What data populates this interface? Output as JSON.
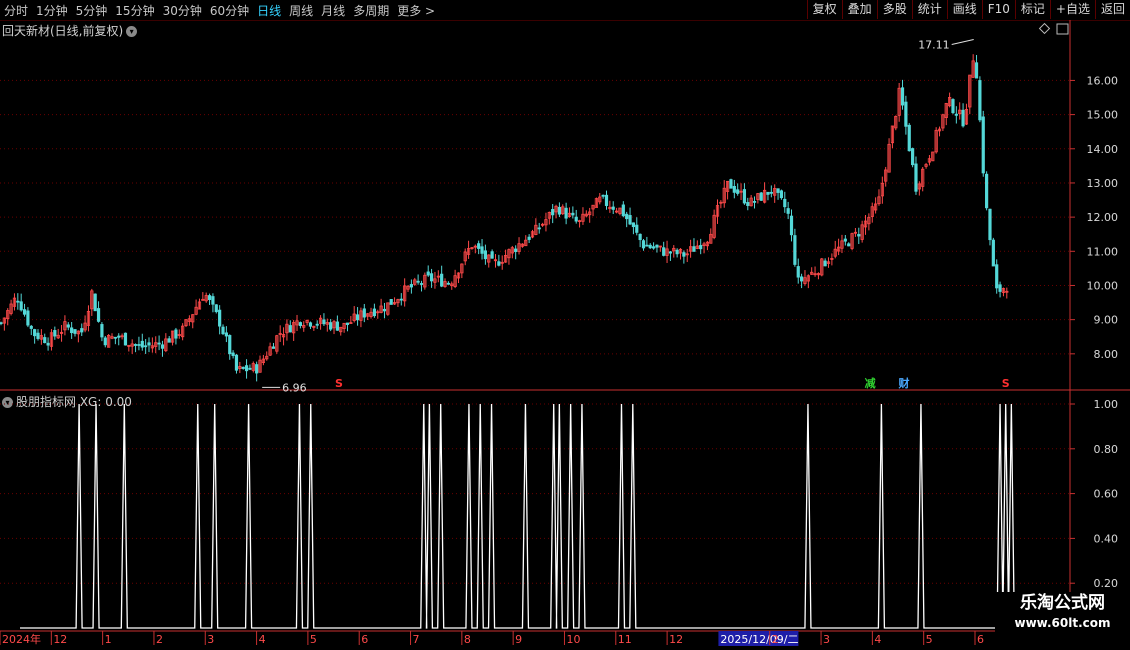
{
  "toolbar": {
    "timeframes": [
      {
        "label": "分时",
        "active": false
      },
      {
        "label": "1分钟",
        "active": false
      },
      {
        "label": "5分钟",
        "active": false
      },
      {
        "label": "15分钟",
        "active": false
      },
      {
        "label": "30分钟",
        "active": false
      },
      {
        "label": "60分钟",
        "active": false
      },
      {
        "label": "日线",
        "active": true
      },
      {
        "label": "周线",
        "active": false
      },
      {
        "label": "月线",
        "active": false
      },
      {
        "label": "多周期",
        "active": false
      },
      {
        "label": "更多 >",
        "active": false
      }
    ],
    "buttons": [
      "复权",
      "叠加",
      "多股",
      "统计",
      "画线",
      "F10",
      "标记",
      "+自选",
      "返回"
    ]
  },
  "main_title": "回天新材(日线,前复权)",
  "indicator_title": "股朋指标网 XG: 0.00",
  "watermark": {
    "line1": "乐淘公式网",
    "line2": "www.60lt.com"
  },
  "colors": {
    "up": "#ff4a4a",
    "down": "#54d8d8",
    "grid": "#6a0000",
    "axis": "#c83030",
    "signal": "#ffffff",
    "date_highlight": "#1e1ea8"
  },
  "chart_data": [
    {
      "type": "candlestick",
      "x_labels": [
        "2024年",
        "12",
        "1",
        "2",
        "3",
        "4",
        "5",
        "6",
        "7",
        "8",
        "9",
        "10",
        "11",
        "12",
        "2025/12/09/二",
        "2",
        "3",
        "4",
        "5",
        "6"
      ],
      "y_ticks": [
        "8.00",
        "9.00",
        "10.00",
        "11.00",
        "12.00",
        "13.00",
        "14.00",
        "15.00",
        "16.00"
      ],
      "ylim": [
        7.0,
        17.3
      ],
      "annotations": [
        {
          "text": "17.11",
          "value": 17.11,
          "kind": "high"
        },
        {
          "text": "6.96",
          "value": 6.96,
          "kind": "low"
        }
      ],
      "event_markers": [
        {
          "text": "S",
          "color": "#ff3030",
          "position": 0.3
        },
        {
          "text": "减",
          "color": "#30d030",
          "position": 0.77
        },
        {
          "text": "财",
          "color": "#4aa8ff",
          "position": 0.8
        },
        {
          "text": "S",
          "color": "#ff3030",
          "position": 0.89
        }
      ],
      "close_path": [
        [
          0.0,
          8.9
        ],
        [
          0.015,
          9.7
        ],
        [
          0.03,
          8.6
        ],
        [
          0.045,
          8.4
        ],
        [
          0.06,
          8.8
        ],
        [
          0.075,
          8.6
        ],
        [
          0.085,
          9.8
        ],
        [
          0.095,
          8.4
        ],
        [
          0.11,
          8.5
        ],
        [
          0.13,
          8.2
        ],
        [
          0.15,
          8.3
        ],
        [
          0.17,
          8.7
        ],
        [
          0.19,
          9.8
        ],
        [
          0.205,
          8.9
        ],
        [
          0.22,
          7.5
        ],
        [
          0.24,
          7.6
        ],
        [
          0.26,
          8.6
        ],
        [
          0.28,
          9.0
        ],
        [
          0.3,
          8.9
        ],
        [
          0.32,
          8.8
        ],
        [
          0.34,
          9.2
        ],
        [
          0.36,
          9.4
        ],
        [
          0.38,
          9.9
        ],
        [
          0.4,
          10.2
        ],
        [
          0.42,
          10.1
        ],
        [
          0.44,
          11.2
        ],
        [
          0.46,
          10.6
        ],
        [
          0.48,
          11.1
        ],
        [
          0.5,
          11.6
        ],
        [
          0.52,
          12.3
        ],
        [
          0.54,
          11.8
        ],
        [
          0.56,
          12.5
        ],
        [
          0.58,
          12.2
        ],
        [
          0.6,
          11.2
        ],
        [
          0.62,
          11.0
        ],
        [
          0.64,
          10.9
        ],
        [
          0.66,
          11.4
        ],
        [
          0.68,
          13.0
        ],
        [
          0.7,
          12.4
        ],
        [
          0.72,
          12.8
        ],
        [
          0.735,
          12.2
        ],
        [
          0.745,
          10.1
        ],
        [
          0.76,
          10.4
        ],
        [
          0.78,
          11.0
        ],
        [
          0.8,
          11.5
        ],
        [
          0.82,
          12.4
        ],
        [
          0.84,
          15.7
        ],
        [
          0.855,
          12.9
        ],
        [
          0.87,
          14.0
        ],
        [
          0.885,
          15.4
        ],
        [
          0.9,
          14.8
        ],
        [
          0.91,
          17.0
        ],
        [
          0.92,
          12.5
        ],
        [
          0.93,
          9.8
        ],
        [
          0.94,
          10.0
        ]
      ]
    },
    {
      "type": "line",
      "name": "XG",
      "y_ticks": [
        "0.20",
        "0.40",
        "0.60",
        "0.80",
        "1.00"
      ],
      "ylim": [
        0,
        1.0
      ],
      "signals": [
        0.07,
        0.085,
        0.11,
        0.175,
        0.19,
        0.22,
        0.265,
        0.275,
        0.375,
        0.38,
        0.39,
        0.415,
        0.425,
        0.435,
        0.465,
        0.49,
        0.495,
        0.505,
        0.515,
        0.55,
        0.56,
        0.715,
        0.78,
        0.815,
        0.885,
        0.89,
        0.895
      ]
    }
  ]
}
